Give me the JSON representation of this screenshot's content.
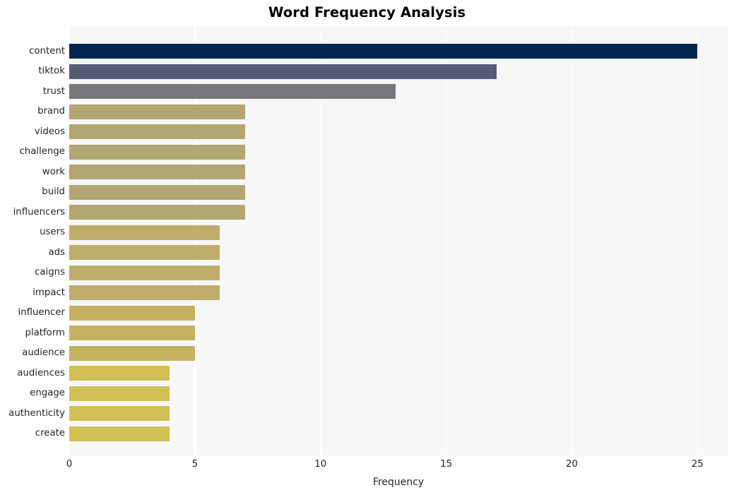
{
  "chart_data": {
    "type": "bar",
    "orientation": "horizontal",
    "title": "Word Frequency Analysis",
    "xlabel": "Frequency",
    "ylabel": "",
    "xlim": [
      0,
      26.2
    ],
    "xticks": [
      "0",
      "5",
      "10",
      "15",
      "20",
      "25"
    ],
    "xtick_values": [
      0,
      5,
      10,
      15,
      20,
      25
    ],
    "grid": true,
    "legend": "none",
    "categories": [
      "content",
      "tiktok",
      "trust",
      "brand",
      "videos",
      "challenge",
      "work",
      "build",
      "influencers",
      "users",
      "ads",
      "caigns",
      "impact",
      "influencer",
      "platform",
      "audience",
      "audiences",
      "engage",
      "authenticity",
      "create"
    ],
    "values": [
      25,
      17,
      13,
      7,
      7,
      7,
      7,
      7,
      7,
      6,
      6,
      6,
      6,
      5,
      5,
      5,
      4,
      4,
      4,
      4
    ],
    "bar_colors": [
      "#04254e",
      "#555b74",
      "#76777b",
      "#b2a672",
      "#b2a672",
      "#b2a672",
      "#b2a672",
      "#b2a672",
      "#b2a672",
      "#bdad68",
      "#bdad68",
      "#bdad68",
      "#bdad68",
      "#c4b260",
      "#c4b260",
      "#c4b260",
      "#d0c055",
      "#d0c055",
      "#d0c055",
      "#d0c055"
    ]
  },
  "style": {
    "plot_background": "#f7f7f7",
    "gridline_color": "#ffffff",
    "figure_background": "#ffffff",
    "text_color": "#262626",
    "title_color": "#000000"
  }
}
